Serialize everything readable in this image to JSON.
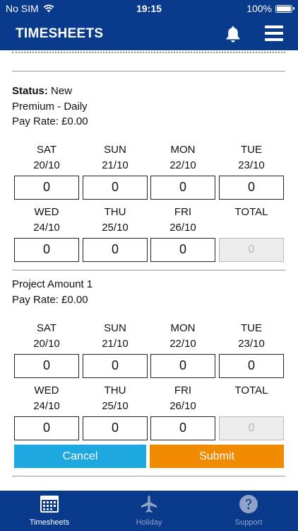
{
  "status_bar": {
    "carrier": "No SIM",
    "time": "19:15",
    "battery": "100%"
  },
  "header": {
    "title": "TIMESHEETS"
  },
  "sections": [
    {
      "lines": [
        {
          "label": "Status:",
          "value": "New"
        },
        {
          "label": "",
          "value": "Premium - Daily"
        },
        {
          "label": "",
          "value": "Pay Rate: £0.00"
        }
      ],
      "days": [
        {
          "name": "SAT",
          "date": "20/10",
          "value": "0"
        },
        {
          "name": "SUN",
          "date": "21/10",
          "value": "0"
        },
        {
          "name": "MON",
          "date": "22/10",
          "value": "0"
        },
        {
          "name": "TUE",
          "date": "23/10",
          "value": "0"
        },
        {
          "name": "WED",
          "date": "24/10",
          "value": "0"
        },
        {
          "name": "THU",
          "date": "25/10",
          "value": "0"
        },
        {
          "name": "FRI",
          "date": "26/10",
          "value": "0"
        }
      ],
      "total": {
        "label": "TOTAL",
        "value": "0"
      }
    },
    {
      "lines": [
        {
          "label": "",
          "value": "Project Amount 1"
        },
        {
          "label": "",
          "value": "Pay Rate: £0.00"
        }
      ],
      "days": [
        {
          "name": "SAT",
          "date": "20/10",
          "value": "0"
        },
        {
          "name": "SUN",
          "date": "21/10",
          "value": "0"
        },
        {
          "name": "MON",
          "date": "22/10",
          "value": "0"
        },
        {
          "name": "TUE",
          "date": "23/10",
          "value": "0"
        },
        {
          "name": "WED",
          "date": "24/10",
          "value": "0"
        },
        {
          "name": "THU",
          "date": "25/10",
          "value": "0"
        },
        {
          "name": "FRI",
          "date": "26/10",
          "value": "0"
        }
      ],
      "total": {
        "label": "TOTAL",
        "value": "0"
      }
    }
  ],
  "buttons": {
    "cancel": "Cancel",
    "submit": "Submit"
  },
  "tabs": [
    {
      "label": "Timesheets",
      "icon": "calendar-icon",
      "active": true
    },
    {
      "label": "Holiday",
      "icon": "airplane-icon",
      "active": false
    },
    {
      "label": "Support",
      "icon": "help-icon",
      "active": false
    }
  ],
  "colors": {
    "brand": "#0a3a8c",
    "cancel": "#1da8e0",
    "submit": "#f08a00"
  }
}
